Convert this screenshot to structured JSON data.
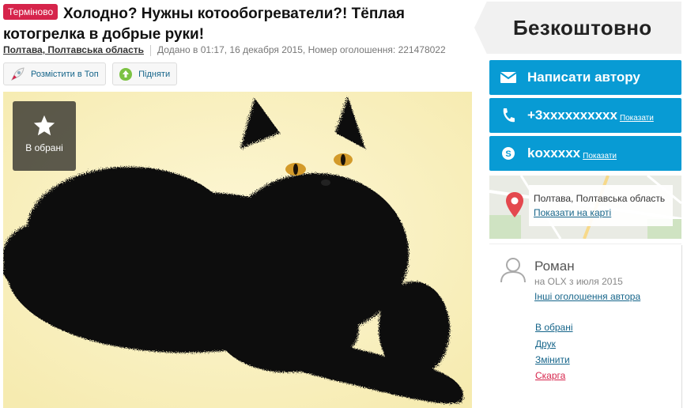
{
  "ad": {
    "badge": "Терміново",
    "title": "Холодно? Нужны котообогреватели?! Тёплая котогрелка в добрые руки!",
    "location": "Полтава, Полтавська область",
    "added": "Додано в 01:17, 16 декабря 2015, Номер оголошення: 221478022"
  },
  "promo": {
    "top_label": "Розмістити в Топ",
    "up_label": "Підняти"
  },
  "photo": {
    "favorite_label": "В обрані"
  },
  "price": "Безкоштовно",
  "contact": {
    "write_label": "Написати автору",
    "phone": "+3xxxxxxxxxx",
    "phone_show": "Показати",
    "skype": "koxxxxx",
    "skype_show": "Показати"
  },
  "map": {
    "location": "Полтава, Полтавська область",
    "show_on_map": "Показати на карті"
  },
  "seller": {
    "name": "Роман",
    "since": "на OLX з июля 2015",
    "other_ads": "Інші оголошення автора"
  },
  "actions": {
    "favorite": "В обрані",
    "print": "Друк",
    "edit": "Змінити",
    "complain": "Скарга"
  },
  "colors": {
    "accent": "#089bd4",
    "badge": "#d6244b",
    "link": "#16658a"
  }
}
